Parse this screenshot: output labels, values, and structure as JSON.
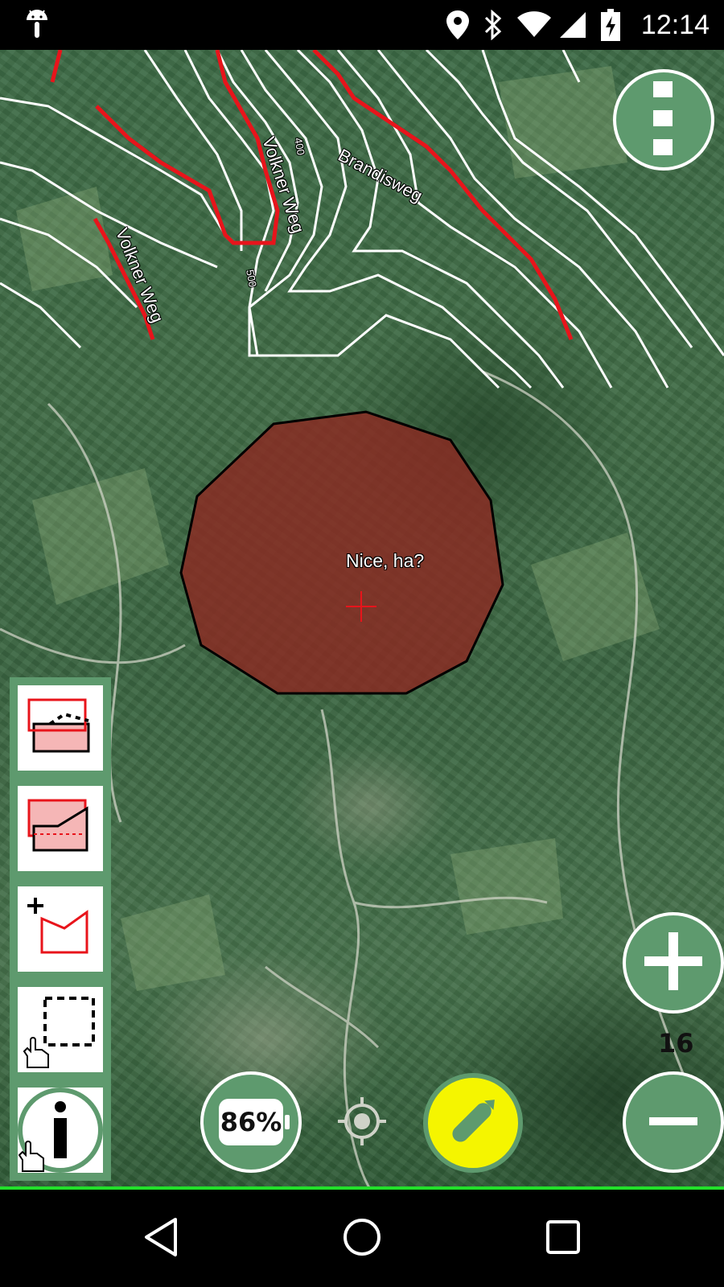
{
  "status_bar": {
    "time": "12:14",
    "icons": [
      "android-icon",
      "location-icon",
      "bluetooth-icon",
      "wifi-icon",
      "cell-signal-icon",
      "battery-charging-icon"
    ]
  },
  "map": {
    "roads": [
      "Brandisweg",
      "Volkner Weg",
      "Volkner Weg"
    ],
    "contour_labels": [
      "400",
      "500"
    ],
    "polygon_label": "Nice, ha?",
    "colors": {
      "road": "#e8141b",
      "contour": "#ffffff",
      "polygon_fill": "#8b2a22",
      "accent": "#5e9a6e",
      "edit_button": "#f5f500"
    }
  },
  "controls": {
    "battery_percent": "86%",
    "zoom_level": "16",
    "menu_icon": "vertical-dots-icon",
    "zoom_in_icon": "plus-icon",
    "zoom_out_icon": "minus-icon",
    "center_icon": "crosshair-target-icon",
    "edit_icon": "pencil-icon"
  },
  "toolbar": {
    "tools": [
      "cut-polygon-tool",
      "merge-polygon-tool",
      "create-polygon-tool",
      "select-rectangle-tool",
      "info-tool"
    ]
  },
  "navigation": [
    "back-icon",
    "home-icon",
    "recents-icon"
  ]
}
